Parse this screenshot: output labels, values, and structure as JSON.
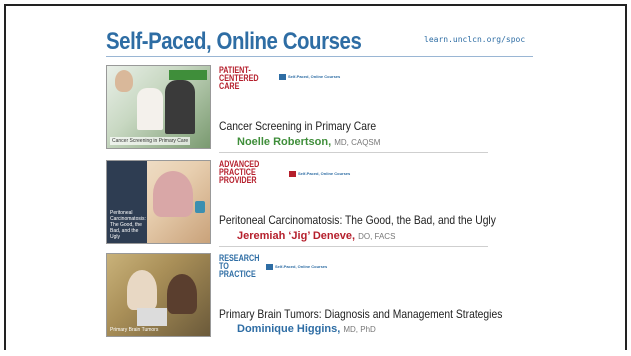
{
  "header": {
    "title": "Self-Paced, Online Courses",
    "url": "learn.unclcn.org/spoc"
  },
  "badge_text": "Self-Paced, Online Courses",
  "courses": [
    {
      "category": "PATIENT-CENTERED CARE",
      "thumb_label": "Cancer Screening in Primary Care",
      "title": "Cancer Screening in Primary Care",
      "author": "Noelle Robertson,",
      "credentials": "MD, CAQSM",
      "color": "#3f8e3a"
    },
    {
      "category": "ADVANCED PRACTICE PROVIDER",
      "thumb_label": "Peritoneal Carcinomatosis: The Good, the Bad, and the Ugly",
      "title": "Peritoneal Carcinomatosis: The Good, the Bad, and the Ugly",
      "author": "Jeremiah ‘Jig’ Deneve,",
      "credentials": "DO, FACS",
      "color": "#b51f2c"
    },
    {
      "category": "RESEARCH TO PRACTICE",
      "thumb_label": "Primary Brain Tumors",
      "title": "Primary Brain Tumors: Diagnosis and Management Strategies",
      "author": "Dominique Higgins,",
      "credentials": "MD, PhD",
      "color": "#2e6da4"
    }
  ]
}
